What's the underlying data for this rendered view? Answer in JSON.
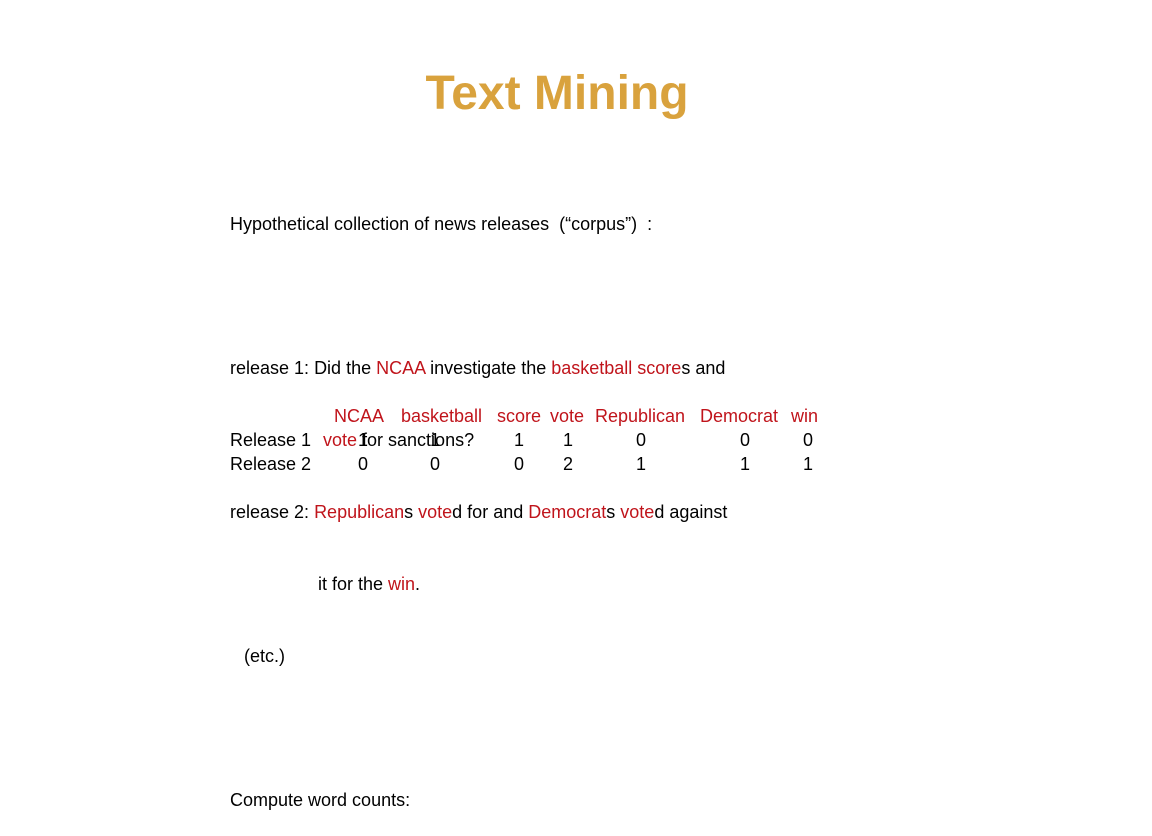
{
  "title": "Text Mining",
  "intro": "Hypothetical collection of news releases  (“corpus”)  :",
  "colors": {
    "title": "#D9A23D",
    "highlight": "#C0141B",
    "text": "#000000"
  },
  "releases": {
    "r1": {
      "label": "release 1: ",
      "segments": [
        {
          "text": "Did the ",
          "highlight": false
        },
        {
          "text": "NCAA",
          "highlight": true
        },
        {
          "text": " investigate the ",
          "highlight": false
        },
        {
          "text": "basketball score",
          "highlight": true
        },
        {
          "text": "s and",
          "highlight": false
        }
      ],
      "cont_segments": [
        {
          "text": "vote",
          "highlight": true
        },
        {
          "text": " for sanctions?",
          "highlight": false
        }
      ]
    },
    "r2": {
      "label": "release 2: ",
      "segments": [
        {
          "text": "Republican",
          "highlight": true
        },
        {
          "text": "s ",
          "highlight": false
        },
        {
          "text": "vote",
          "highlight": true
        },
        {
          "text": "d for and ",
          "highlight": false
        },
        {
          "text": "Democrat",
          "highlight": true
        },
        {
          "text": "s ",
          "highlight": false
        },
        {
          "text": "vote",
          "highlight": true
        },
        {
          "text": "d against",
          "highlight": false
        }
      ],
      "cont_segments": [
        {
          "text": "it for the ",
          "highlight": false
        },
        {
          "text": "win",
          "highlight": true
        },
        {
          "text": ".",
          "highlight": false
        }
      ]
    },
    "etc": "(etc.)"
  },
  "compute_label": "Compute word counts:",
  "table": {
    "headers": [
      "NCAA",
      "basketball",
      "score",
      "vote",
      "Republican",
      "Democrat",
      "win"
    ],
    "rows": [
      {
        "label": "Release 1",
        "values": [
          "1",
          "1",
          "1",
          "1",
          "0",
          "0",
          "0"
        ]
      },
      {
        "label": "Release 2",
        "values": [
          "0",
          "0",
          "0",
          "2",
          "1",
          "1",
          "1"
        ]
      }
    ]
  }
}
